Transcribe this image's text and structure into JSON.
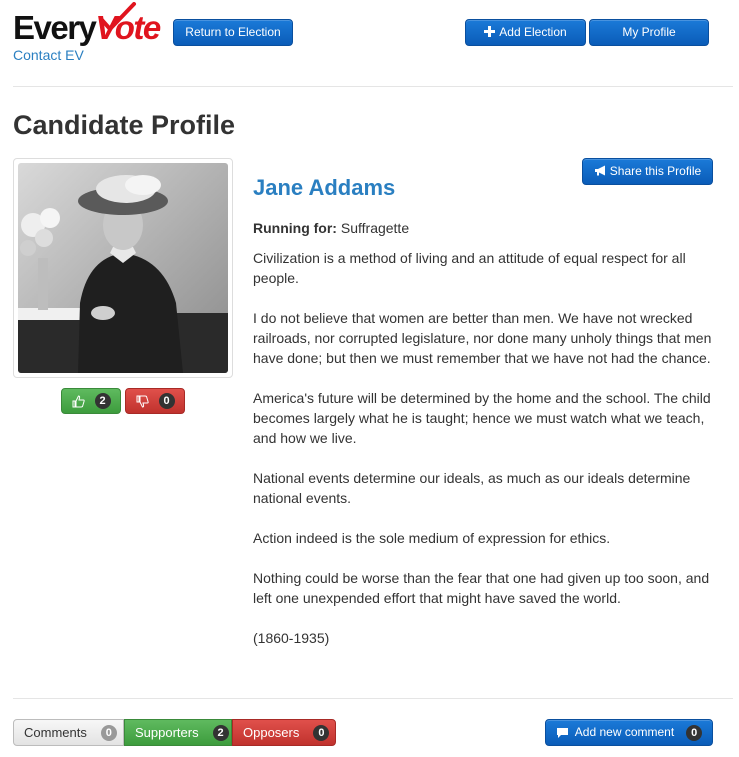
{
  "header": {
    "logo_every": "Every",
    "logo_vote": "Vote",
    "contact_link": "Contact EV",
    "return_button": "Return to Election",
    "add_election_button": "Add Election",
    "my_profile_button": "My Profile"
  },
  "page": {
    "title": "Candidate Profile"
  },
  "candidate": {
    "name": "Jane Addams",
    "running_for_label": "Running for:",
    "running_for_value": "Suffragette",
    "share_button": "Share this Profile",
    "votes": {
      "up_count": "2",
      "down_count": "0"
    },
    "bio": [
      "Civilization is a method of living and an attitude of equal respect for all people.",
      "I do not believe that women are better than men. We have not wrecked railroads, nor corrupted legislature, nor done many unholy things that men have done; but then we must remember that we have not had the chance.",
      "America's future will be determined by the home and the school. The child becomes largely what he is taught; hence we must watch what we teach, and how we live.",
      "National events determine our ideals, as much as our ideals determine national events.",
      "Action indeed is the sole medium of expression for ethics.",
      "Nothing could be worse than the fear that one had given up too soon, and left one unexpended effort that might have saved the world.",
      "(1860-1935)"
    ]
  },
  "tabs": {
    "comments": {
      "label": "Comments",
      "count": "0"
    },
    "supporters": {
      "label": "Supporters",
      "count": "2"
    },
    "opposers": {
      "label": "Opposers",
      "count": "0"
    }
  },
  "comment": {
    "add_button": "Add new comment",
    "count": "0"
  },
  "colors": {
    "brand_red": "#e0141e",
    "link_blue": "#2a7fc1",
    "button_blue": "#0a5cb8",
    "success_green": "#3d9c3d",
    "danger_red": "#c0322d"
  },
  "icons": {
    "add_election": "plus-icon",
    "share": "megaphone-icon",
    "vote_up": "thumbs-up-icon",
    "vote_down": "thumbs-down-icon",
    "add_comment": "comment-icon"
  }
}
